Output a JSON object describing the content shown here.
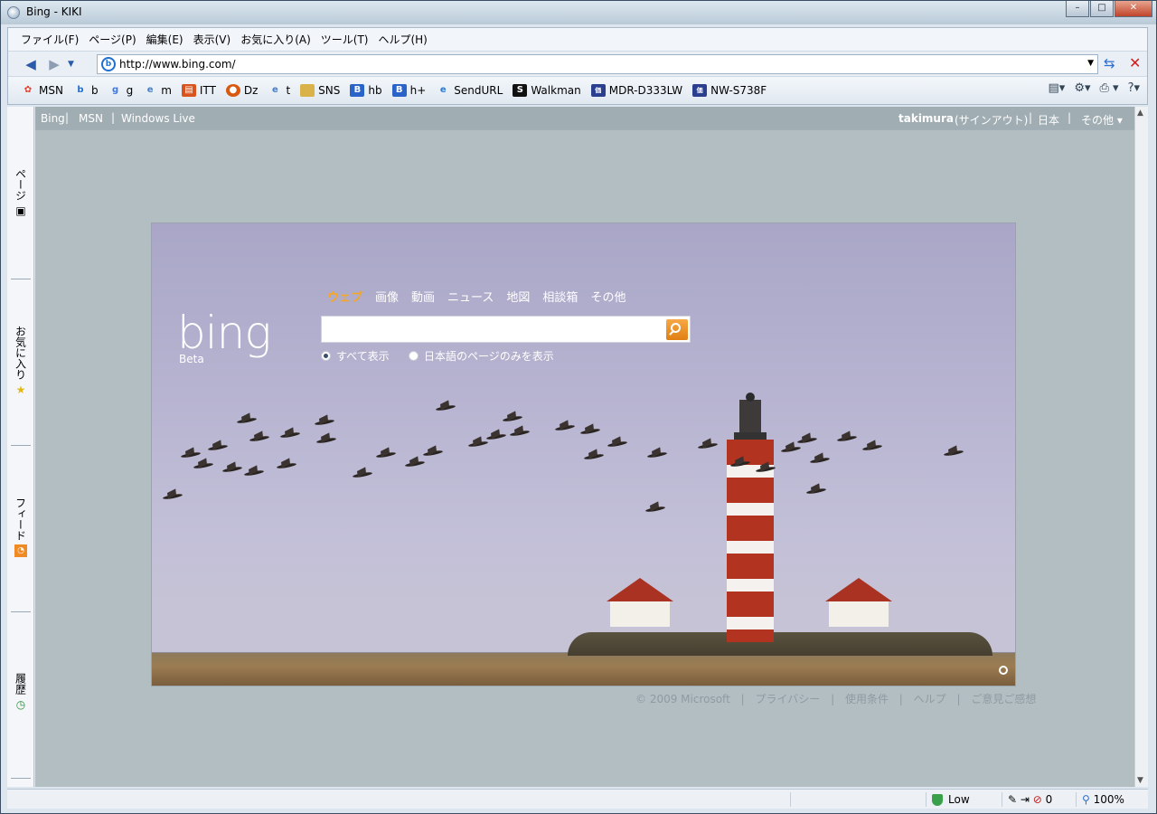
{
  "window": {
    "title": "Bing - KIKI",
    "controls": [
      "–",
      "□",
      "✕"
    ]
  },
  "menubar": {
    "items": [
      "ファイル(F)",
      "ページ(P)",
      "編集(E)",
      "表示(V)",
      "お気に入り(A)",
      "ツール(T)",
      "ヘルプ(H)"
    ]
  },
  "address": {
    "url": "http://www.bing.com/"
  },
  "favorites": [
    {
      "label": "MSN",
      "icon": "msn-icon",
      "color": "#e23c2a"
    },
    {
      "label": "b",
      "icon": "bing-icon",
      "color": "#1f6fd1"
    },
    {
      "label": "g",
      "icon": "google-icon",
      "color": "#3b78e7"
    },
    {
      "label": "m",
      "icon": "ie-page-icon",
      "color": "#4a7fc1"
    },
    {
      "label": "ITT",
      "icon": "itt-icon",
      "color": "#d9531e"
    },
    {
      "label": "Dz",
      "icon": "dz-icon",
      "color": "#d85a10"
    },
    {
      "label": "t",
      "icon": "ie-page-icon",
      "color": "#4a7fc1"
    },
    {
      "label": "SNS",
      "icon": "folder-icon",
      "color": "#d9b34a"
    },
    {
      "label": "hb",
      "icon": "hatena-icon",
      "color": "#2b64c8"
    },
    {
      "label": "h+",
      "icon": "hatena-icon",
      "color": "#2b64c8"
    },
    {
      "label": "SendURL",
      "icon": "ie-icon",
      "color": "#2f7bd3"
    },
    {
      "label": "Walkman",
      "icon": "s-icon",
      "color": "#111111"
    },
    {
      "label": "MDR-D333LW",
      "icon": "kakaku-icon",
      "color": "#2a3f8f"
    },
    {
      "label": "NW-S738F",
      "icon": "kakaku-icon",
      "color": "#2a3f8f"
    }
  ],
  "sidebar": {
    "tabs": [
      "ページ",
      "お気に入り",
      "フィード",
      "履歴"
    ]
  },
  "bing_header": {
    "left_links": [
      "Bing",
      "MSN",
      "Windows Live"
    ],
    "user": "takimura",
    "signout": "(サインアウト)",
    "country": "日本",
    "more": "その他 ▾"
  },
  "bing": {
    "logo": "bing",
    "beta": "Beta",
    "tabs": [
      "ウェブ",
      "画像",
      "動画",
      "ニュース",
      "地図",
      "相談箱",
      "その他"
    ],
    "active_tab": "ウェブ",
    "search_value": "",
    "scope_all": "すべて表示",
    "scope_japanese": "日本語のページのみを表示",
    "scope_selected": "すべて表示"
  },
  "footer": {
    "links": [
      "© 2009 Microsoft",
      "|",
      "プライバシー",
      "|",
      "使用条件",
      "|",
      "ヘルプ",
      "|",
      "ご意見ご感想"
    ]
  },
  "statusbar": {
    "security": "Low",
    "popup_count": "0",
    "zoom": "100%"
  }
}
